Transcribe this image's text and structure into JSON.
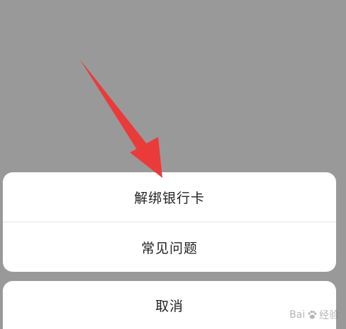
{
  "action_sheet": {
    "items": [
      {
        "label": "解绑银行卡"
      },
      {
        "label": "常见问题"
      }
    ],
    "cancel_label": "取消"
  },
  "annotation": {
    "arrow_color": "#ea3b3b"
  },
  "watermark": {
    "text_left": "Bai",
    "text_right": "经验"
  }
}
